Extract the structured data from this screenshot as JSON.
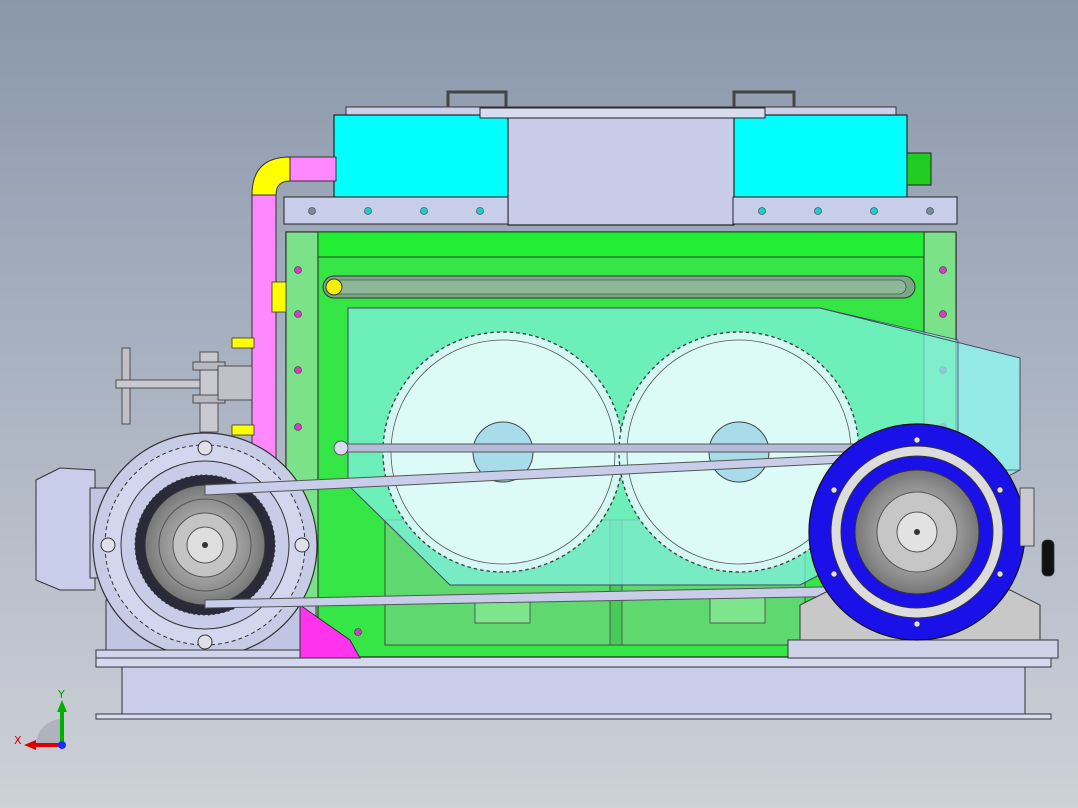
{
  "triad": {
    "x_label": "X",
    "y_label": "Y",
    "colors": {
      "x": "#e00000",
      "y": "#00b000",
      "z": "#1a2cff"
    }
  },
  "colors": {
    "hopper": "#00ffff",
    "housing": "#33e844",
    "guard": "#66eedd",
    "pipe": "#ff88ff",
    "elbow": "#ffff00",
    "pulley": "#1a10e8",
    "base": "#c8cde8",
    "motor": "#c8cfe8"
  }
}
